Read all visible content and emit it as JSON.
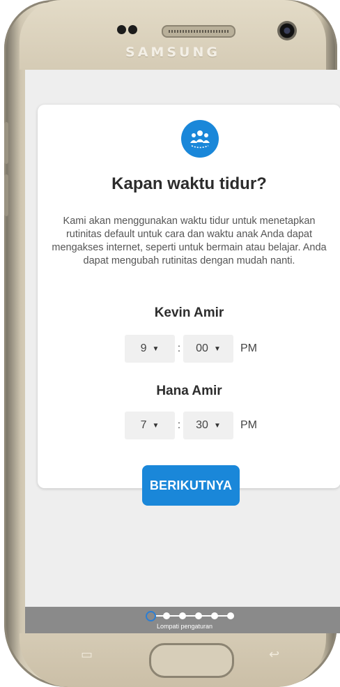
{
  "device": {
    "brand": "SAMSUNG"
  },
  "onboarding": {
    "title": "Kapan waktu tidur?",
    "description": "Kami akan menggunakan waktu tidur untuk menetapkan rutinitas default untuk cara dan waktu anak Anda dapat mengakses internet, seperti untuk bermain atau belajar. Anda dapat mengubah rutinitas dengan mudah nanti.",
    "children": [
      {
        "name": "Kevin Amir",
        "hour": "9",
        "minute": "00",
        "ampm": "PM"
      },
      {
        "name": "Hana Amir",
        "hour": "7",
        "minute": "30",
        "ampm": "PM"
      }
    ],
    "separator": ":",
    "next_label": "BERIKUTNYA"
  },
  "footer": {
    "skip_label": "Lompati pengaturan",
    "steps_total": 6,
    "current_step": 1
  },
  "icons": {
    "header": "family-group-icon",
    "dropdown": "caret-down-icon"
  },
  "colors": {
    "accent": "#1a87d9",
    "footer": "#8a8a8a",
    "screen_bg": "#eeeeee"
  }
}
